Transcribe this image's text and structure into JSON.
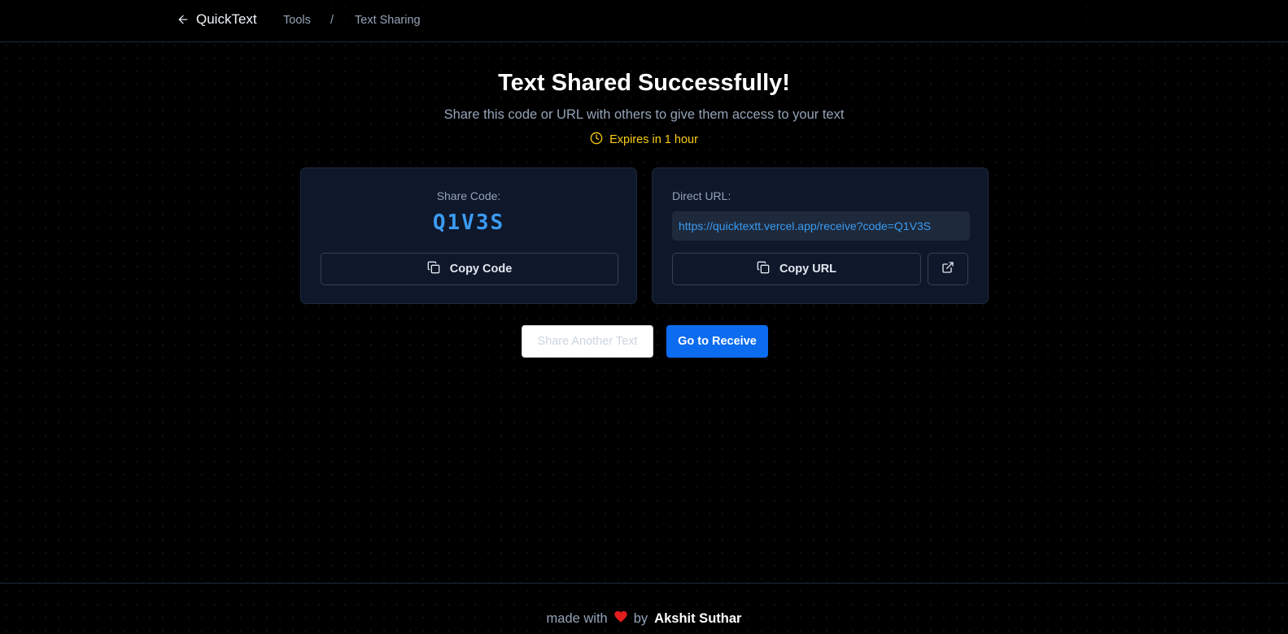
{
  "header": {
    "brand": "QuickText",
    "breadcrumb": {
      "tools": "Tools",
      "separator": "/",
      "current": "Text Sharing"
    }
  },
  "main": {
    "title": "Text Shared Successfully!",
    "subtitle": "Share this code or URL with others to give them access to your text",
    "expiry": "Expires in 1 hour"
  },
  "share_code_card": {
    "label": "Share Code:",
    "code": "Q1V3S",
    "copy_label": "Copy Code"
  },
  "url_card": {
    "label": "Direct URL:",
    "url": "https://quicktextt.vercel.app/receive?code=Q1V3S",
    "copy_label": "Copy URL"
  },
  "actions": {
    "share_another": "Share Another Text",
    "go_receive": "Go to Receive"
  },
  "footer": {
    "made_with": "made with",
    "by": "by",
    "author": "Akshit Suthar"
  },
  "colors": {
    "accent": "#0b6cf0",
    "code_blue": "#3b9bf2",
    "expiry_yellow": "#facc15",
    "heart_red": "#e11d1d",
    "card_bg": "#0f172a"
  },
  "icons": [
    "arrow-left-icon",
    "clock-icon",
    "copy-icon",
    "external-link-icon",
    "heart-icon"
  ]
}
